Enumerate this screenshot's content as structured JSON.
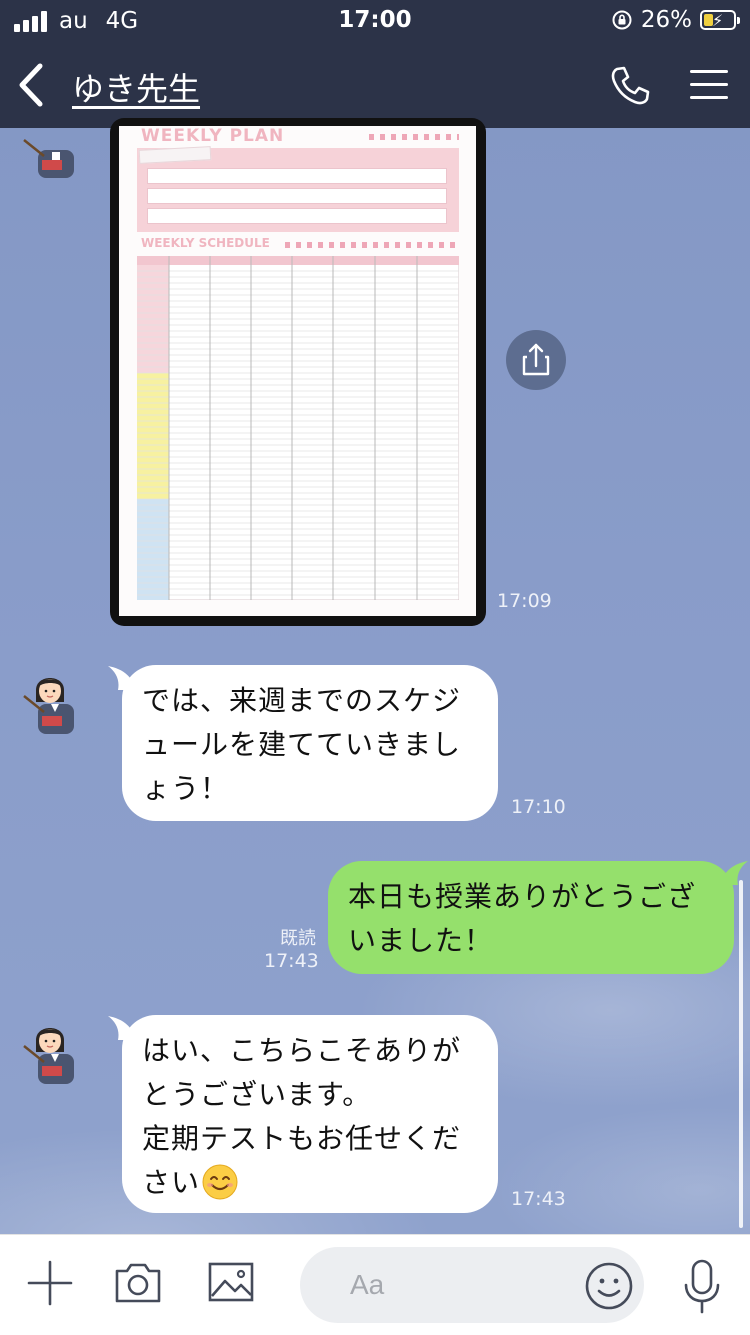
{
  "status_bar": {
    "carrier": "au",
    "network": "4G",
    "time": "17:00",
    "battery_percent": "26%",
    "battery_level": 0.26
  },
  "header": {
    "title": "ゆき先生"
  },
  "messages": [
    {
      "type": "image",
      "sender": "incoming",
      "image_texts": {
        "plan_title": "WEEKLY PLAN",
        "schedule_title": "WEEKLY SCHEDULE"
      },
      "time": "17:09"
    },
    {
      "type": "text",
      "sender": "incoming",
      "lines": [
        "では、来週までのスケジ",
        "ュールを建てていきまし",
        "ょう！"
      ],
      "time": "17:10"
    },
    {
      "type": "text",
      "sender": "outgoing",
      "lines": [
        "本日も授業ありがとうござ",
        "いました！"
      ],
      "read": "既読",
      "time": "17:43"
    },
    {
      "type": "text",
      "sender": "incoming",
      "lines": [
        "はい、こちらこそありが",
        "とうございます。",
        "定期テストもお任せくだ",
        "さい"
      ],
      "emoji": "😊",
      "time": "17:43"
    }
  ],
  "input_bar": {
    "placeholder": "Aa"
  },
  "colors": {
    "header_bg": "#2c3348",
    "outgoing_bubble": "#95e06c",
    "incoming_bubble": "#ffffff",
    "chat_bg": "#8a9ec8"
  },
  "icons": [
    "back-icon",
    "phone-icon",
    "menu-icon",
    "share-icon",
    "plus-icon",
    "camera-icon",
    "image-icon",
    "emoji-icon",
    "microphone-icon"
  ]
}
